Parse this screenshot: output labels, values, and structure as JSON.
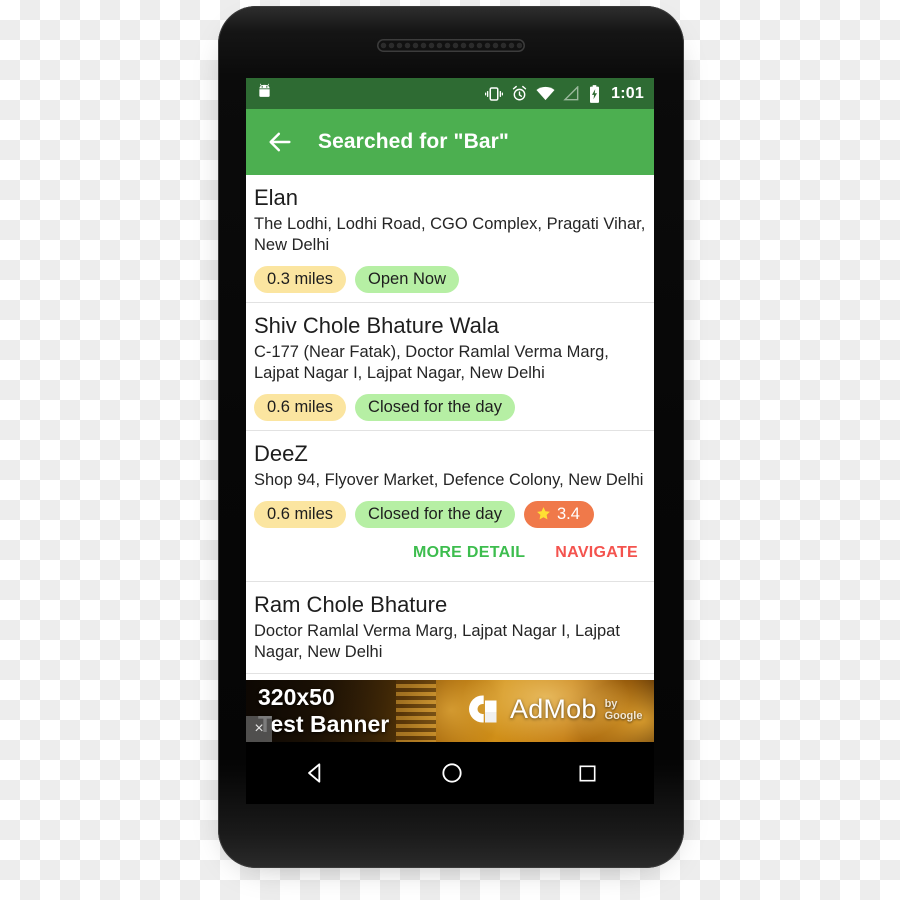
{
  "device": {
    "speaker_name": "earpiece-speaker"
  },
  "status_bar": {
    "time": "1:01",
    "icons": [
      "android-robot-icon",
      "vibrate-icon",
      "alarm-icon",
      "wifi-icon",
      "signal-icon",
      "battery-charging-icon"
    ]
  },
  "toolbar": {
    "back_label": "back-arrow-icon",
    "title": "Searched for \"Bar\""
  },
  "results": [
    {
      "name": "Elan",
      "address": "The Lodhi, Lodhi Road, CGO Complex, Pragati Vihar, New Delhi",
      "distance": "0.3 miles",
      "status": "Open Now",
      "rating": null,
      "actions": null
    },
    {
      "name": "Shiv Chole Bhature Wala",
      "address": "C-177 (Near Fatak), Doctor Ramlal Verma Marg, Lajpat Nagar I, Lajpat Nagar, New Delhi",
      "distance": "0.6 miles",
      "status": "Closed for the day",
      "rating": null,
      "actions": null
    },
    {
      "name": "DeeZ",
      "address": "Shop 94, Flyover Market, Defence Colony, New Delhi",
      "distance": "0.6 miles",
      "status": "Closed for the day",
      "rating": "3.4",
      "actions": {
        "more_detail": "MORE DETAIL",
        "navigate": "NAVIGATE"
      }
    },
    {
      "name": "Ram Chole Bhature",
      "address": "Doctor Ramlal Verma Marg, Lajpat Nagar I, Lajpat Nagar, New Delhi",
      "distance": null,
      "status": null,
      "rating": null,
      "actions": null
    }
  ],
  "ad": {
    "headline": "320x50\nTest Banner",
    "brand": "AdMob",
    "byline": "by Google",
    "close_label": "×"
  },
  "nav_bar": {
    "back": "nav-back-icon",
    "home": "nav-home-icon",
    "recents": "nav-recents-icon"
  },
  "colors": {
    "status_bar": "#2e6b33",
    "toolbar": "#4caf50",
    "chip_distance": "#fbe5a0",
    "chip_status": "#b6efa4",
    "chip_rating": "#f0794a",
    "action_more": "#3dbd4e",
    "action_navigate": "#f4534e"
  }
}
